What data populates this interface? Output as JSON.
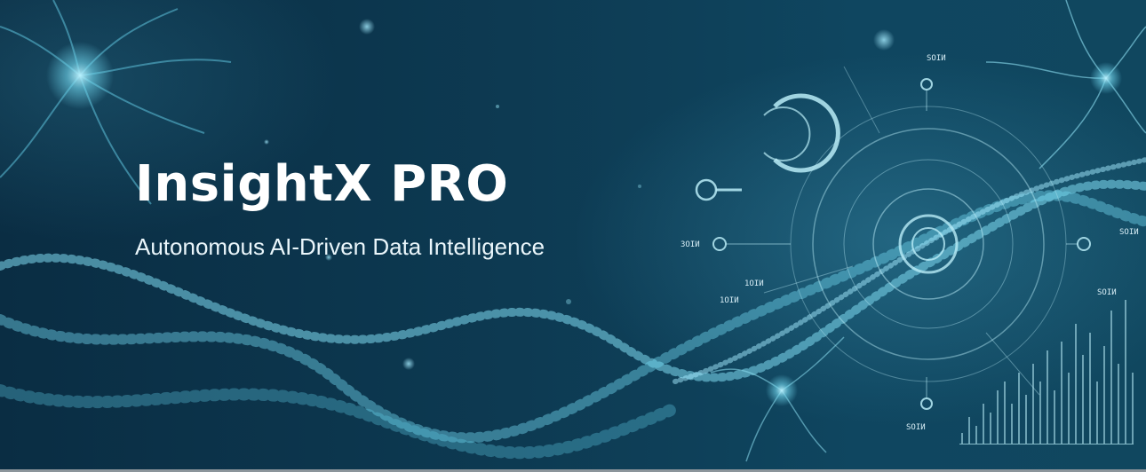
{
  "hero": {
    "title": "InsightX PRO",
    "subtitle": "Autonomous AI-Driven Data Intelligence"
  },
  "hud_labels": {
    "top": "SOIИ",
    "left": "3OIИ",
    "right": "SOIИ",
    "mid_upper": "1OIИ",
    "mid_lower": "1OIИ",
    "chart": "SOIИ",
    "bottom": "SOIИ"
  },
  "colors": {
    "background": "#0b2f45",
    "accent": "#6fd3ea",
    "title": "#ffffff"
  },
  "icons": [
    "neuron-icon",
    "dna-helix-icon",
    "radar-icon",
    "bar-chart-icon"
  ]
}
